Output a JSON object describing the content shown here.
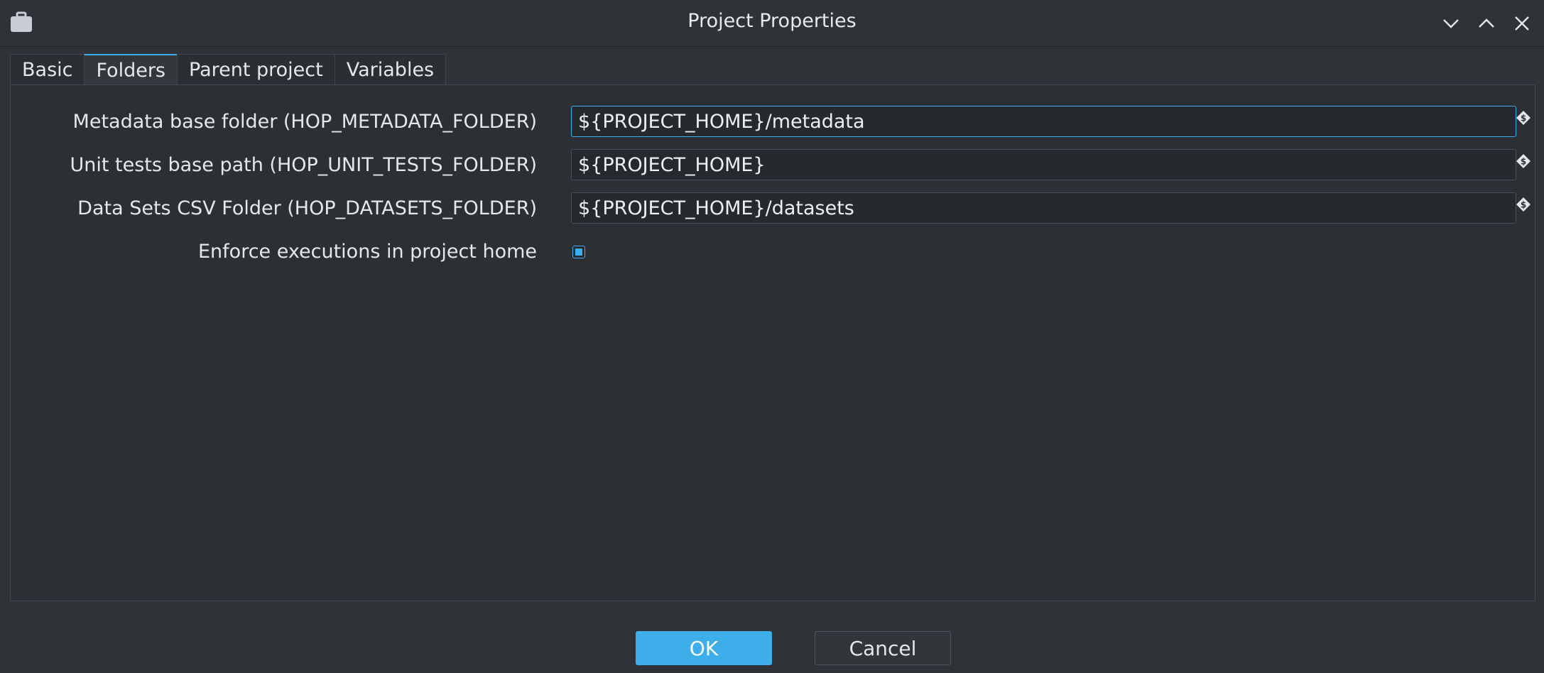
{
  "window": {
    "title": "Project Properties",
    "icon": "briefcase-icon"
  },
  "tabs": [
    {
      "label": "Basic",
      "active": false
    },
    {
      "label": "Folders",
      "active": true
    },
    {
      "label": "Parent project",
      "active": false
    },
    {
      "label": "Variables",
      "active": false
    }
  ],
  "fields": [
    {
      "label": "Metadata base folder (HOP_METADATA_FOLDER)",
      "value": "${PROJECT_HOME}/metadata",
      "focused": true
    },
    {
      "label": "Unit tests base path (HOP_UNIT_TESTS_FOLDER)",
      "value": "${PROJECT_HOME}",
      "focused": false
    },
    {
      "label": "Data Sets CSV Folder (HOP_DATASETS_FOLDER)",
      "value": "${PROJECT_HOME}/datasets",
      "focused": false
    }
  ],
  "enforce": {
    "label": "Enforce executions in project home",
    "checked": true
  },
  "buttons": {
    "ok": "OK",
    "cancel": "Cancel"
  },
  "colors": {
    "accent": "#3daee9",
    "background": "#2f3237"
  }
}
